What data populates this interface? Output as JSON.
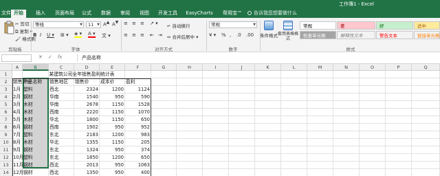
{
  "window": {
    "title": "工作簿1 - Excel"
  },
  "tabs": [
    {
      "label": "文件",
      "active": false
    },
    {
      "label": "开始",
      "active": true
    },
    {
      "label": "插入",
      "active": false
    },
    {
      "label": "页面布局",
      "active": false
    },
    {
      "label": "公式",
      "active": false
    },
    {
      "label": "数据",
      "active": false
    },
    {
      "label": "审阅",
      "active": false
    },
    {
      "label": "视图",
      "active": false
    },
    {
      "label": "开发工具",
      "active": false
    },
    {
      "label": "EasyCharts",
      "active": false
    },
    {
      "label": "帮用宝™",
      "active": false
    }
  ],
  "tell_me": "告诉我您想要做什么",
  "ribbon": {
    "clipboard": {
      "cut": "剪切",
      "copy": "复制 ▾",
      "format_painter": "格式刷",
      "label": "剪贴板"
    },
    "font": {
      "name": "等线",
      "size": "11",
      "label": "字体"
    },
    "alignment": {
      "wrap": "自动换行",
      "merge": "合并后居中 ▾",
      "label": "对齐方式"
    },
    "number": {
      "format": "常规",
      "label": "数字"
    },
    "styles": {
      "conditional": "条件格式",
      "table_format": "套用表格格式",
      "label": "样式",
      "cells": [
        {
          "label": "常规",
          "bg": "#ffffff",
          "color": "#000000"
        },
        {
          "label": "差",
          "bg": "#ffc7ce",
          "color": "#9c0006"
        },
        {
          "label": "好",
          "bg": "#c6efce",
          "color": "#006100"
        },
        {
          "label": "适中",
          "bg": "#ffeb9c",
          "color": "#9c5700"
        },
        {
          "label": "检查单元格",
          "bg": "#a5a5a5",
          "color": "#ffffff"
        },
        {
          "label": "解释性文本",
          "bg": "#f3f3f3",
          "color": "#7f7f7f"
        },
        {
          "label": "警告文本",
          "bg": "#f3f3f3",
          "color": "#ff0000"
        },
        {
          "label": "链接单元格",
          "bg": "#f3f3f3",
          "color": "#fa7d00"
        }
      ]
    }
  },
  "formula_bar": {
    "fx": "fx",
    "content": "产品名称"
  },
  "columns": [
    "A",
    "B",
    "C",
    "D",
    "E",
    "F",
    "G",
    "H",
    "I",
    "J",
    "K",
    "L",
    "M",
    "N",
    "O",
    "P",
    "Q"
  ],
  "selected_column": "B",
  "rows": [
    "1",
    "2",
    "3",
    "4",
    "5",
    "6",
    "7",
    "8",
    "9",
    "10",
    "11",
    "12",
    "13",
    "14"
  ],
  "sheet": {
    "title": "某建筑公司全年销售盈利统计表",
    "headers": [
      "销售月份",
      "产品名称",
      "销售地区",
      "销售价",
      "成本价",
      "盈利"
    ],
    "records": [
      [
        "1月",
        "塑料",
        "西北",
        "2324",
        "1200",
        "1124"
      ],
      [
        "2月",
        "钢材",
        "华南",
        "1540",
        "950",
        "590"
      ],
      [
        "3月",
        "木材",
        "华南",
        "2678",
        "1150",
        "1528"
      ],
      [
        "4月",
        "木材",
        "西南",
        "2220",
        "1150",
        "1070"
      ],
      [
        "5月",
        "木材",
        "华北",
        "1800",
        "1150",
        "650"
      ],
      [
        "6月",
        "钢材",
        "西南",
        "1902",
        "950",
        "952"
      ],
      [
        "7月",
        "塑料",
        "东北",
        "2183",
        "1200",
        "983"
      ],
      [
        "8月",
        "木材",
        "华北",
        "1355",
        "1150",
        "205"
      ],
      [
        "9月",
        "钢材",
        "东北",
        "1324",
        "950",
        "374"
      ],
      [
        "10月",
        "塑料",
        "东北",
        "1850",
        "1200",
        "650"
      ],
      [
        "11月",
        "钢材",
        "西北",
        "2013",
        "950",
        "1063"
      ],
      [
        "12月",
        "钢材",
        "西北",
        "1350",
        "950",
        "400"
      ]
    ]
  },
  "colors": {
    "brand": "#217346",
    "selection": "#d3d3d3"
  }
}
